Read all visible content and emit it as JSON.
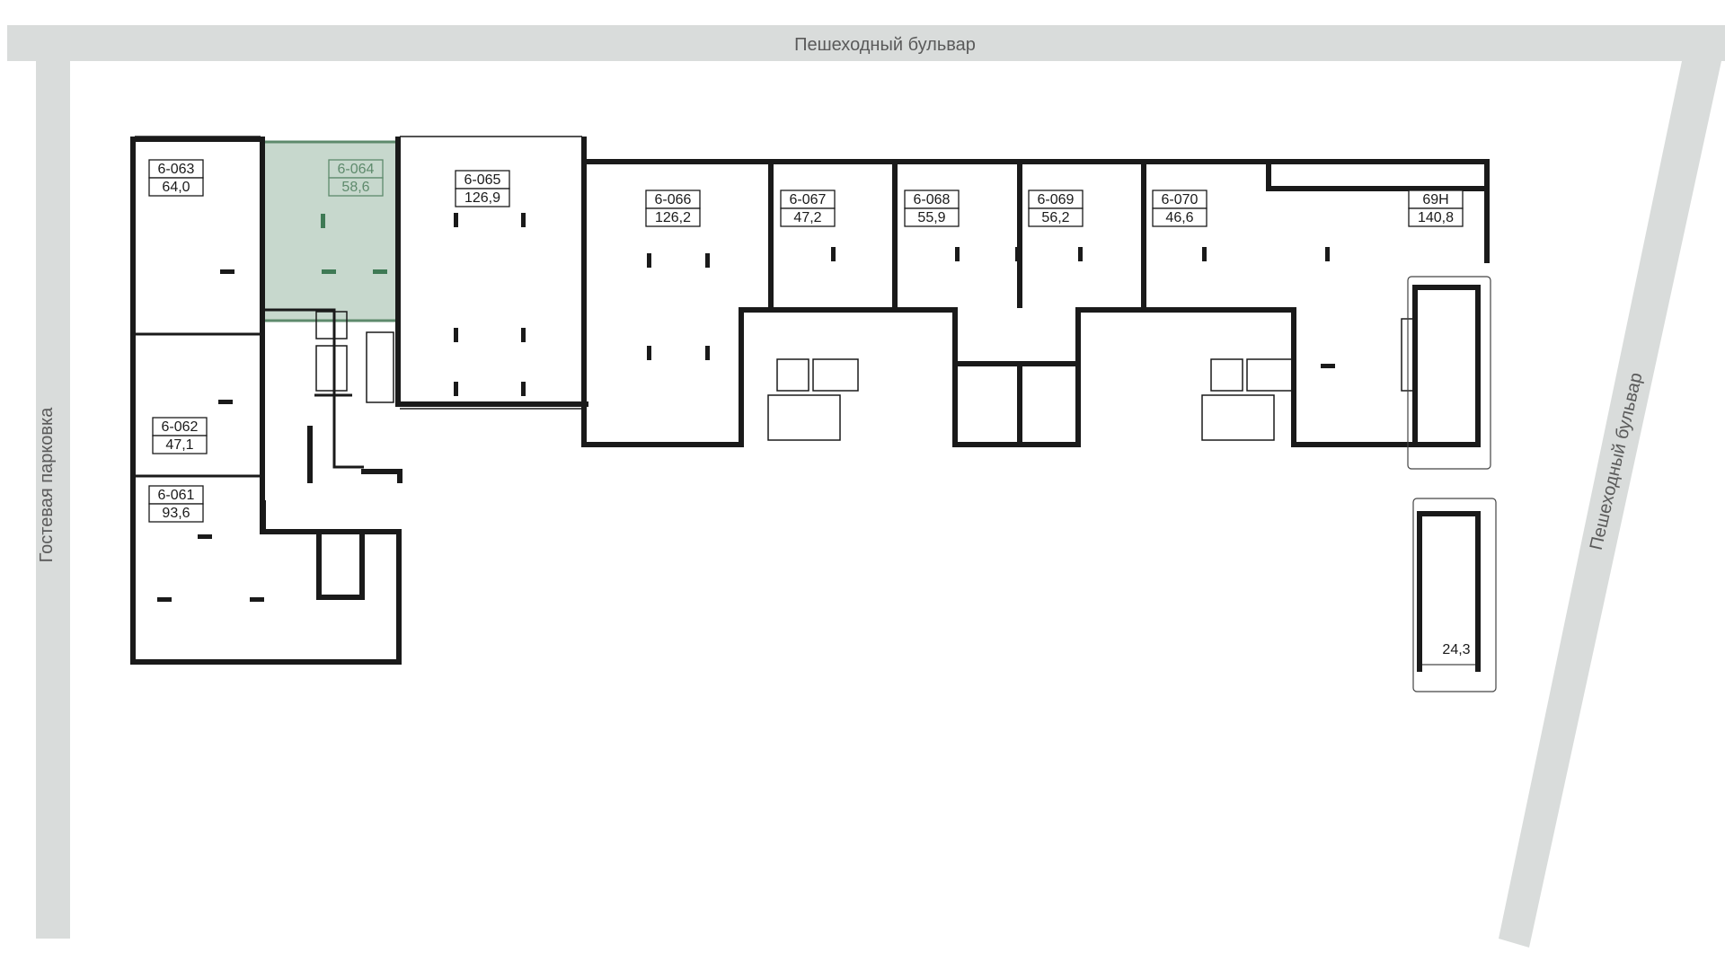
{
  "roads": {
    "top": "Пешеходный бульвар",
    "left": "Гостевая парковка",
    "right": "Пешеходный бульвар"
  },
  "units": [
    {
      "id": "6-063",
      "area": "64,0",
      "selected": false
    },
    {
      "id": "6-064",
      "area": "58,6",
      "selected": true
    },
    {
      "id": "6-065",
      "area": "126,9",
      "selected": false
    },
    {
      "id": "6-062",
      "area": "47,1",
      "selected": false
    },
    {
      "id": "6-061",
      "area": "93,6",
      "selected": false
    },
    {
      "id": "6-066",
      "area": "126,2",
      "selected": false
    },
    {
      "id": "6-067",
      "area": "47,2",
      "selected": false
    },
    {
      "id": "6-068",
      "area": "55,9",
      "selected": false
    },
    {
      "id": "6-069",
      "area": "56,2",
      "selected": false
    },
    {
      "id": "6-070",
      "area": "46,6",
      "selected": false
    },
    {
      "id": "69Н",
      "area": "140,8",
      "selected": false
    }
  ],
  "terrace_area": "24,3",
  "colors": {
    "road": "#d9dcdb",
    "selected_fill": "#c7d8cd",
    "selected_stroke": "#5e8a6c",
    "wall": "#1a1a1a"
  }
}
